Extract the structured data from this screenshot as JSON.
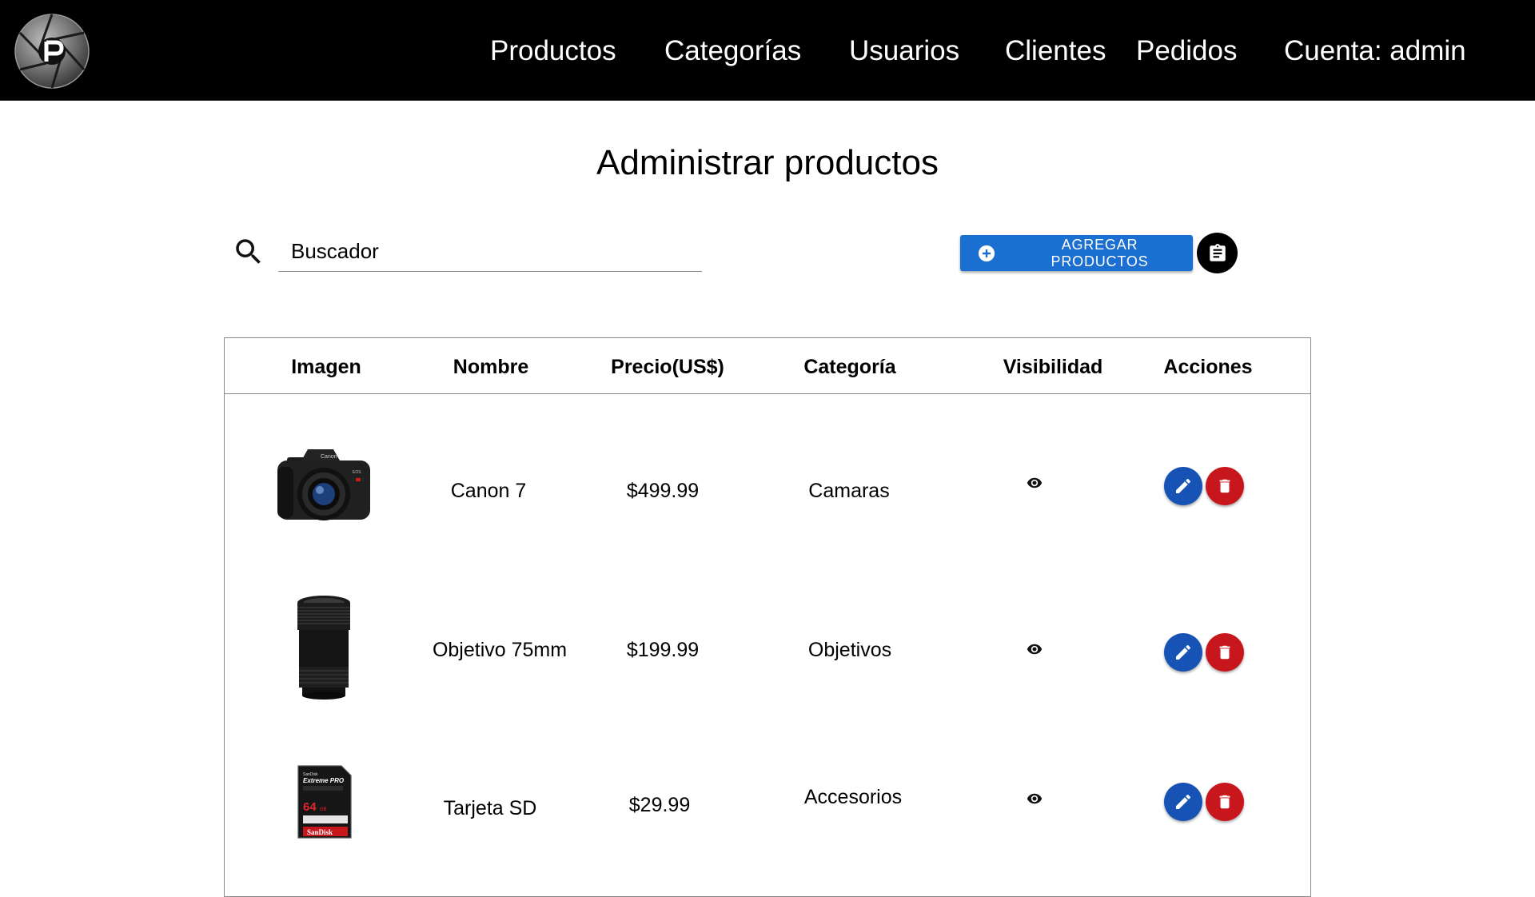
{
  "header": {
    "nav": [
      {
        "label": "Productos"
      },
      {
        "label": "Categorías"
      },
      {
        "label": "Usuarios"
      },
      {
        "label": "Clientes"
      },
      {
        "label": "Pedidos"
      },
      {
        "label": "Cuenta: admin"
      }
    ]
  },
  "main": {
    "title": "Administrar productos",
    "search": {
      "placeholder": "Buscador",
      "value": ""
    },
    "add_button": {
      "label": "AGREGAR PRODUCTOS"
    },
    "table": {
      "columns": [
        "Imagen",
        "Nombre",
        "Precio(US$)",
        "Categoría",
        "Visibilidad",
        "Acciones"
      ],
      "rows": [
        {
          "name": "Canon 7",
          "price": "$499.99",
          "category": "Camaras",
          "image": "dslr-camera",
          "visible": true
        },
        {
          "name": "Objetivo 75mm",
          "price": "$199.99",
          "category": "Objetivos",
          "image": "camera-lens",
          "visible": true
        },
        {
          "name": "Tarjeta SD",
          "price": "$29.99",
          "category": "Accesorios",
          "image": "sd-card",
          "visible": true
        }
      ]
    }
  },
  "sd_card_print": {
    "line1": "SanDisk",
    "line2": "Extreme PRO",
    "capacity": "64",
    "unit": "GB",
    "brand": "SanDisk"
  },
  "camera_print": {
    "brand": "Canon",
    "model": "EOS"
  },
  "colors": {
    "header_bg": "#000000",
    "primary": "#1a6fd1",
    "edit": "#1752b5",
    "delete": "#c8161d"
  },
  "icons": [
    "logo-aperture",
    "search-icon",
    "add-circle-icon",
    "clipboard-icon",
    "eye-icon",
    "pencil-icon",
    "trash-icon"
  ]
}
